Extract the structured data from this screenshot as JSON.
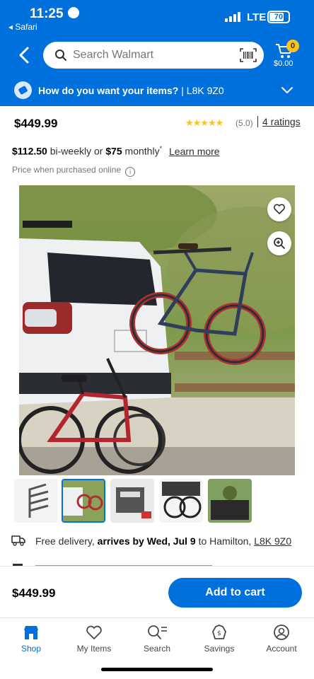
{
  "status_bar": {
    "time": "11:25",
    "back_app": "◂ Safari",
    "network": "LTE",
    "battery": "70"
  },
  "header": {
    "search_placeholder": "Search Walmart",
    "cart_count": "0",
    "cart_total": "$0.00",
    "delivery_prompt": "How do you want your items?",
    "delivery_separator": " | ",
    "postal_code": "L8K 9Z0"
  },
  "product": {
    "price": "$449.99",
    "rating_value": "(5.0)",
    "rating_stars": 5,
    "ratings_link": "4 ratings",
    "finance": {
      "biweekly_amount": "$112.50",
      "biweekly_text": " bi-weekly or ",
      "monthly_amount": "$75",
      "monthly_text": " monthly",
      "asterisk": "*",
      "learn_more": "Learn more"
    },
    "price_note": "Price when purchased online",
    "info_symbol": "i",
    "thumbnail_count": 5,
    "selected_thumbnail": 1
  },
  "delivery": {
    "prefix": "Free delivery, ",
    "arrives": "arrives by Wed, Jul 9",
    "middle": " to Hamilton, ",
    "postal": "L8K 9Z0"
  },
  "sticky_bar": {
    "price": "$449.99",
    "add_to_cart": "Add to cart"
  },
  "tabs": [
    {
      "label": "Shop",
      "icon": "shop-icon",
      "active": true
    },
    {
      "label": "My Items",
      "icon": "heart-icon",
      "active": false
    },
    {
      "label": "Search",
      "icon": "search-icon",
      "active": false
    },
    {
      "label": "Savings",
      "icon": "savings-icon",
      "active": false
    },
    {
      "label": "Account",
      "icon": "account-icon",
      "active": false
    }
  ],
  "colors": {
    "brand_blue": "#0071dc",
    "spark_yellow": "#ffc220",
    "text": "#2e2f32"
  }
}
